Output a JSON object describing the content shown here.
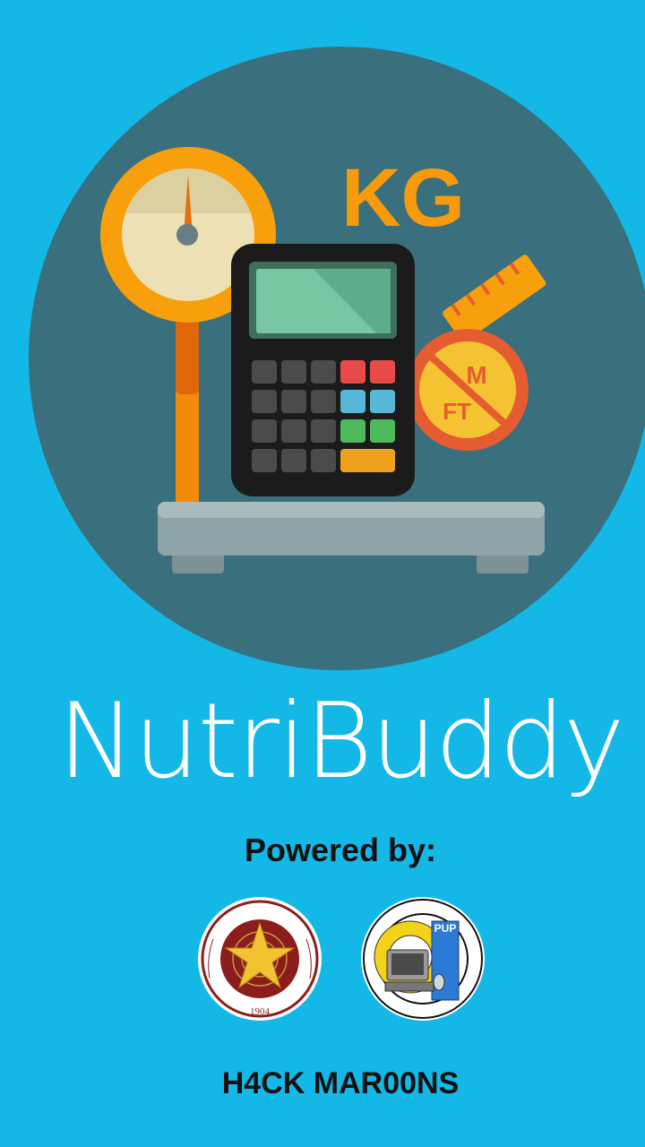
{
  "splash": {
    "hero": {
      "scale_unit_text": "KG",
      "tape_labels": [
        "M",
        "FT"
      ],
      "icons": [
        "weighing-scale-icon",
        "calculator-icon",
        "measuring-tape-icon"
      ]
    },
    "app_title": "NutriBuddy",
    "powered_by": "Powered by:",
    "sponsors": [
      {
        "name": "POLYTECHNIC UNIVERSITY OF THE PHILIPPINES",
        "year": "1904",
        "icon": "pup-seal-icon"
      },
      {
        "name": "COLLEGE OF COMPUTER AND INFORMATION SCIENCES",
        "badge": "PUP",
        "icon": "ccis-seal-icon"
      }
    ],
    "team_name": "H4CK MAR00NS"
  },
  "colors": {
    "background": "#14b8e6",
    "circle": "#3a6f7d",
    "accent_orange": "#f79a0c",
    "title_text": "#ffffff",
    "body_text": "#111111"
  }
}
